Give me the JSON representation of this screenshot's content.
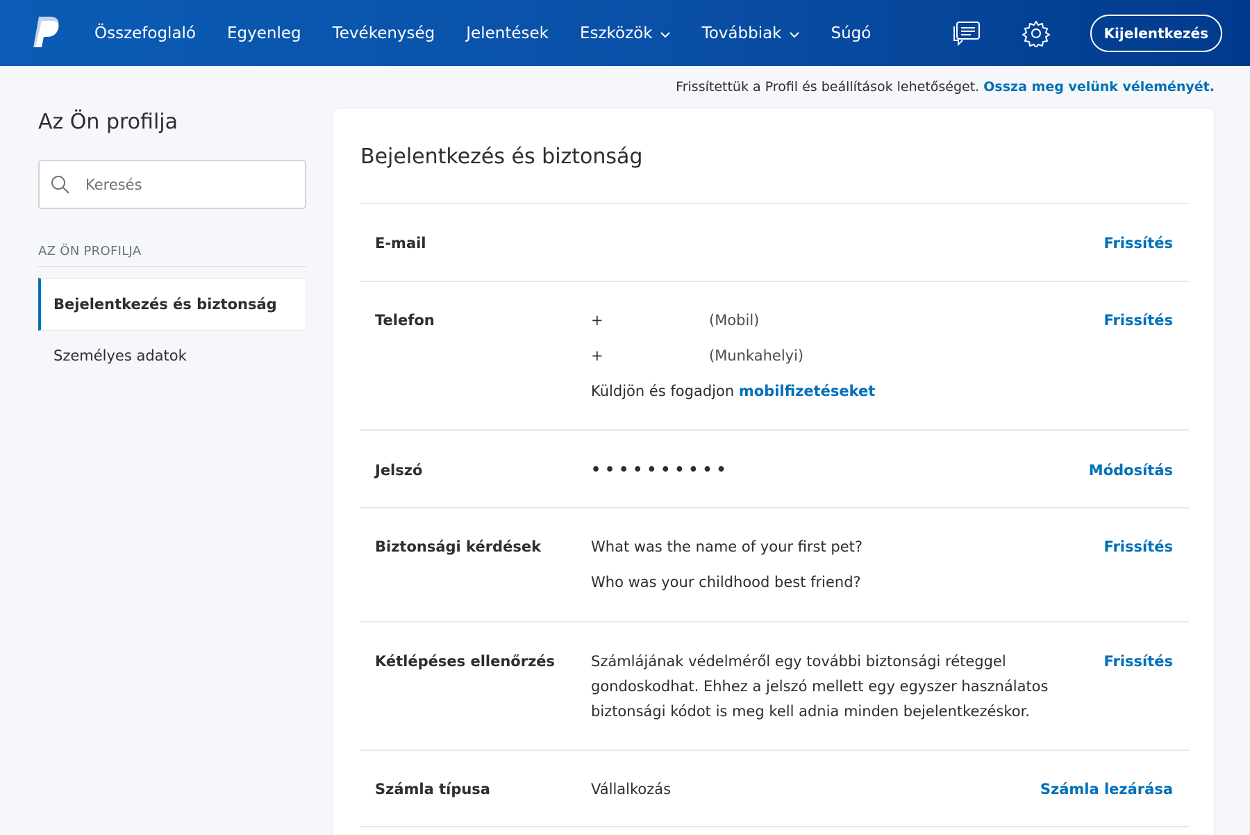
{
  "header": {
    "logo_icon": "paypal-logo",
    "nav": [
      {
        "label": "Összefoglaló"
      },
      {
        "label": "Egyenleg"
      },
      {
        "label": "Tevékenység"
      },
      {
        "label": "Jelentések"
      },
      {
        "label": "Eszközök",
        "dropdown": true
      },
      {
        "label": "Továbbiak",
        "dropdown": true
      },
      {
        "label": "Súgó"
      }
    ],
    "messages_icon": "message-center-icon",
    "settings_icon": "gear-icon",
    "logout_label": "Kijelentkezés",
    "colors": {
      "bar_start": "#0b5cb6",
      "bar_end": "#003a8c",
      "text": "#ffffff"
    }
  },
  "feedback": {
    "text": "Frissítettük a Profil és beállítások lehetőséget.",
    "link": "Ossza meg velünk véleményét."
  },
  "sidebar": {
    "title": "Az Ön profilja",
    "search_placeholder": "Keresés",
    "section_label": "AZ ÖN PROFILJA",
    "items": [
      {
        "label": "Bejelentkezés és biztonság",
        "active": true
      },
      {
        "label": "Személyes adatok",
        "active": false
      }
    ]
  },
  "main": {
    "title": "Bejelentkezés és biztonság",
    "rows": {
      "email": {
        "label": "E-mail",
        "action": "Frissítés"
      },
      "phone": {
        "label": "Telefon",
        "mobile_prefix": "+",
        "mobile_type": "(Mobil)",
        "work_prefix": "+",
        "work_type": "(Munkahelyi)",
        "mobile_pay_text": "Küldjön és fogadjon",
        "mobile_pay_link": "mobilfizetéseket",
        "action": "Frissítés"
      },
      "password": {
        "label": "Jelszó",
        "value": "••••••••••",
        "action": "Módosítás"
      },
      "security_questions": {
        "label": "Biztonsági kérdések",
        "q1": "What was the name of your first pet?",
        "q2": "Who was your childhood best friend?",
        "action": "Frissítés"
      },
      "two_step": {
        "label": "Kétlépéses ellenőrzés",
        "line1": "Számlájának védelméről egy további biztonsági réteggel",
        "line2": "gondoskodhat. Ehhez a jelszó mellett egy egyszer használatos",
        "line3": "biztonsági kódot is meg kell adnia minden bejelentkezéskor.",
        "action": "Frissítés"
      },
      "account_type": {
        "label": "Számla típusa",
        "value": "Vállalkozás",
        "action": "Számla lezárása"
      }
    },
    "accent_color": "#0070ba"
  }
}
